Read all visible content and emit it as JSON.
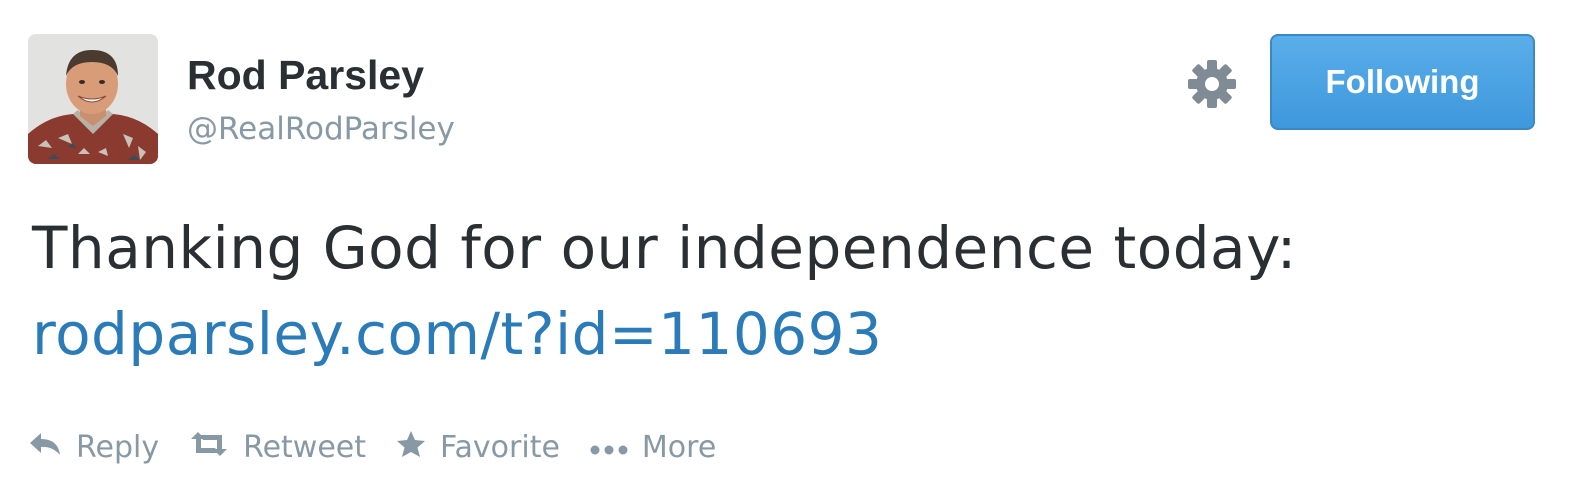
{
  "user": {
    "name": "Rod Parsley",
    "handle": "@RealRodParsley"
  },
  "header": {
    "follow_label": "Following",
    "settings_icon": "gear-icon"
  },
  "tweet": {
    "text": "Thanking God for our independence today:",
    "link": "rodparsley.com/t?id=110693"
  },
  "actions": {
    "reply": {
      "label": "Reply",
      "icon": "reply-icon"
    },
    "retweet": {
      "label": "Retweet",
      "icon": "retweet-icon"
    },
    "favorite": {
      "label": "Favorite",
      "icon": "star-icon"
    },
    "more": {
      "label": "More",
      "icon": "more-dots-icon"
    }
  },
  "colors": {
    "accent": "#55acee",
    "link": "#2b7bb9",
    "text": "#292f33",
    "muted": "#8899a6"
  }
}
